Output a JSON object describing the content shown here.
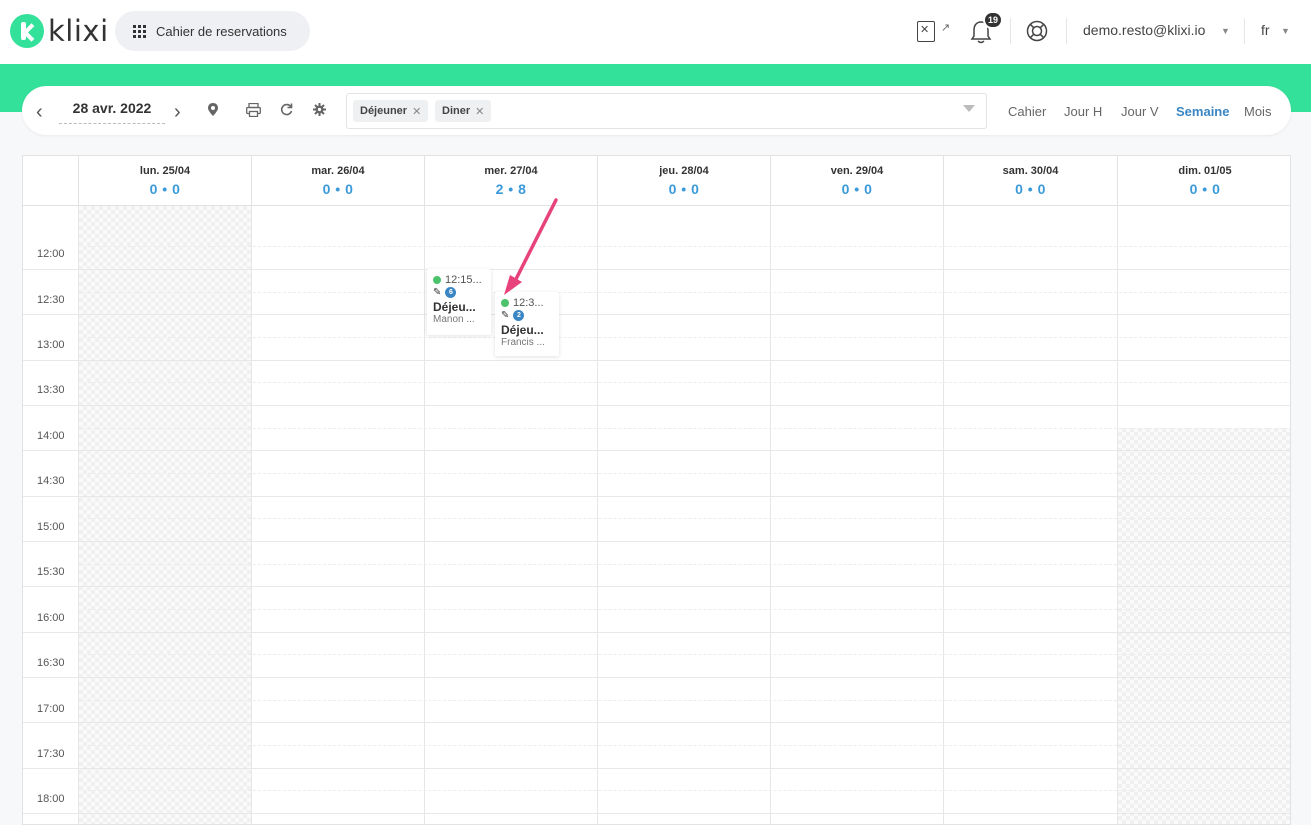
{
  "header": {
    "logo_text": "klixi",
    "book_button": "Cahier de reservations",
    "notification_count": "19",
    "user_email": "demo.resto@klixi.io",
    "language": "fr"
  },
  "toolbar": {
    "date": "28 avr. 2022",
    "filters": [
      "Déjeuner",
      "Diner"
    ],
    "views": [
      "Cahier",
      "Jour H",
      "Jour V",
      "Semaine",
      "Mois"
    ],
    "active_view": "Semaine"
  },
  "calendar": {
    "days": [
      {
        "name": "lun. 25/04",
        "count": "0 • 0"
      },
      {
        "name": "mar. 26/04",
        "count": "0 • 0"
      },
      {
        "name": "mer. 27/04",
        "count": "2 • 8"
      },
      {
        "name": "jeu. 28/04",
        "count": "0 • 0"
      },
      {
        "name": "ven. 29/04",
        "count": "0 • 0"
      },
      {
        "name": "sam. 30/04",
        "count": "0 • 0"
      },
      {
        "name": "dim. 01/05",
        "count": "0 • 0"
      }
    ],
    "times": [
      "12:00",
      "12:30",
      "13:00",
      "13:30",
      "14:00",
      "14:30",
      "15:00",
      "15:30",
      "16:00",
      "16:30",
      "17:00",
      "17:30",
      "18:00"
    ],
    "events": [
      {
        "time": "12:15...",
        "covers": "6",
        "title": "Déjeu...",
        "name": "Manon ..."
      },
      {
        "time": "12:3...",
        "covers": "2",
        "title": "Déjeu...",
        "name": "Francis ..."
      }
    ]
  },
  "colors": {
    "brand_green": "#34e19a",
    "accent_blue": "#3a86c4",
    "count_blue": "#3a9ad9",
    "status_green": "#4cc26c",
    "annotation_arrow": "#e8427c"
  }
}
